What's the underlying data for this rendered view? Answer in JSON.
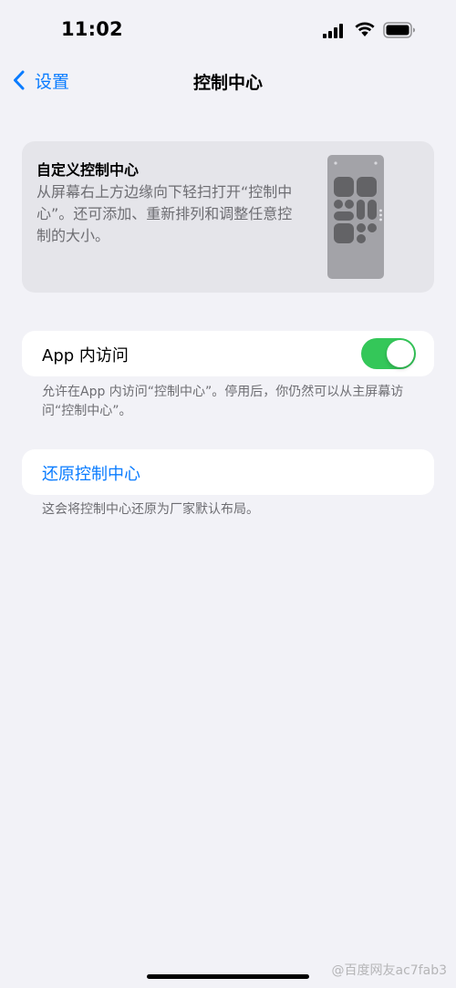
{
  "status_bar": {
    "time": "11:02"
  },
  "nav": {
    "back_label": "设置",
    "title": "控制中心"
  },
  "info_card": {
    "title": "自定义控制中心",
    "description": "从屏幕右上方边缘向下轻扫打开“控制中心”。还可添加、重新排列和调整任意控制的大小。"
  },
  "in_app_access": {
    "label": "App 内访问",
    "enabled": true,
    "footnote": "允许在App 内访问“控制中心”。停用后，你仍然可以从主屏幕访问“控制中心”。"
  },
  "reset": {
    "label": "还原控制中心",
    "footnote": "这会将控制中心还原为厂家默认布局。"
  },
  "watermark": "@百度网友ac7fab3",
  "colors": {
    "accent": "#0a7cff",
    "toggle_on": "#34c759",
    "background": "#f2f2f7",
    "card": "#e5e5ea",
    "secondary_text": "#6d6d72"
  }
}
